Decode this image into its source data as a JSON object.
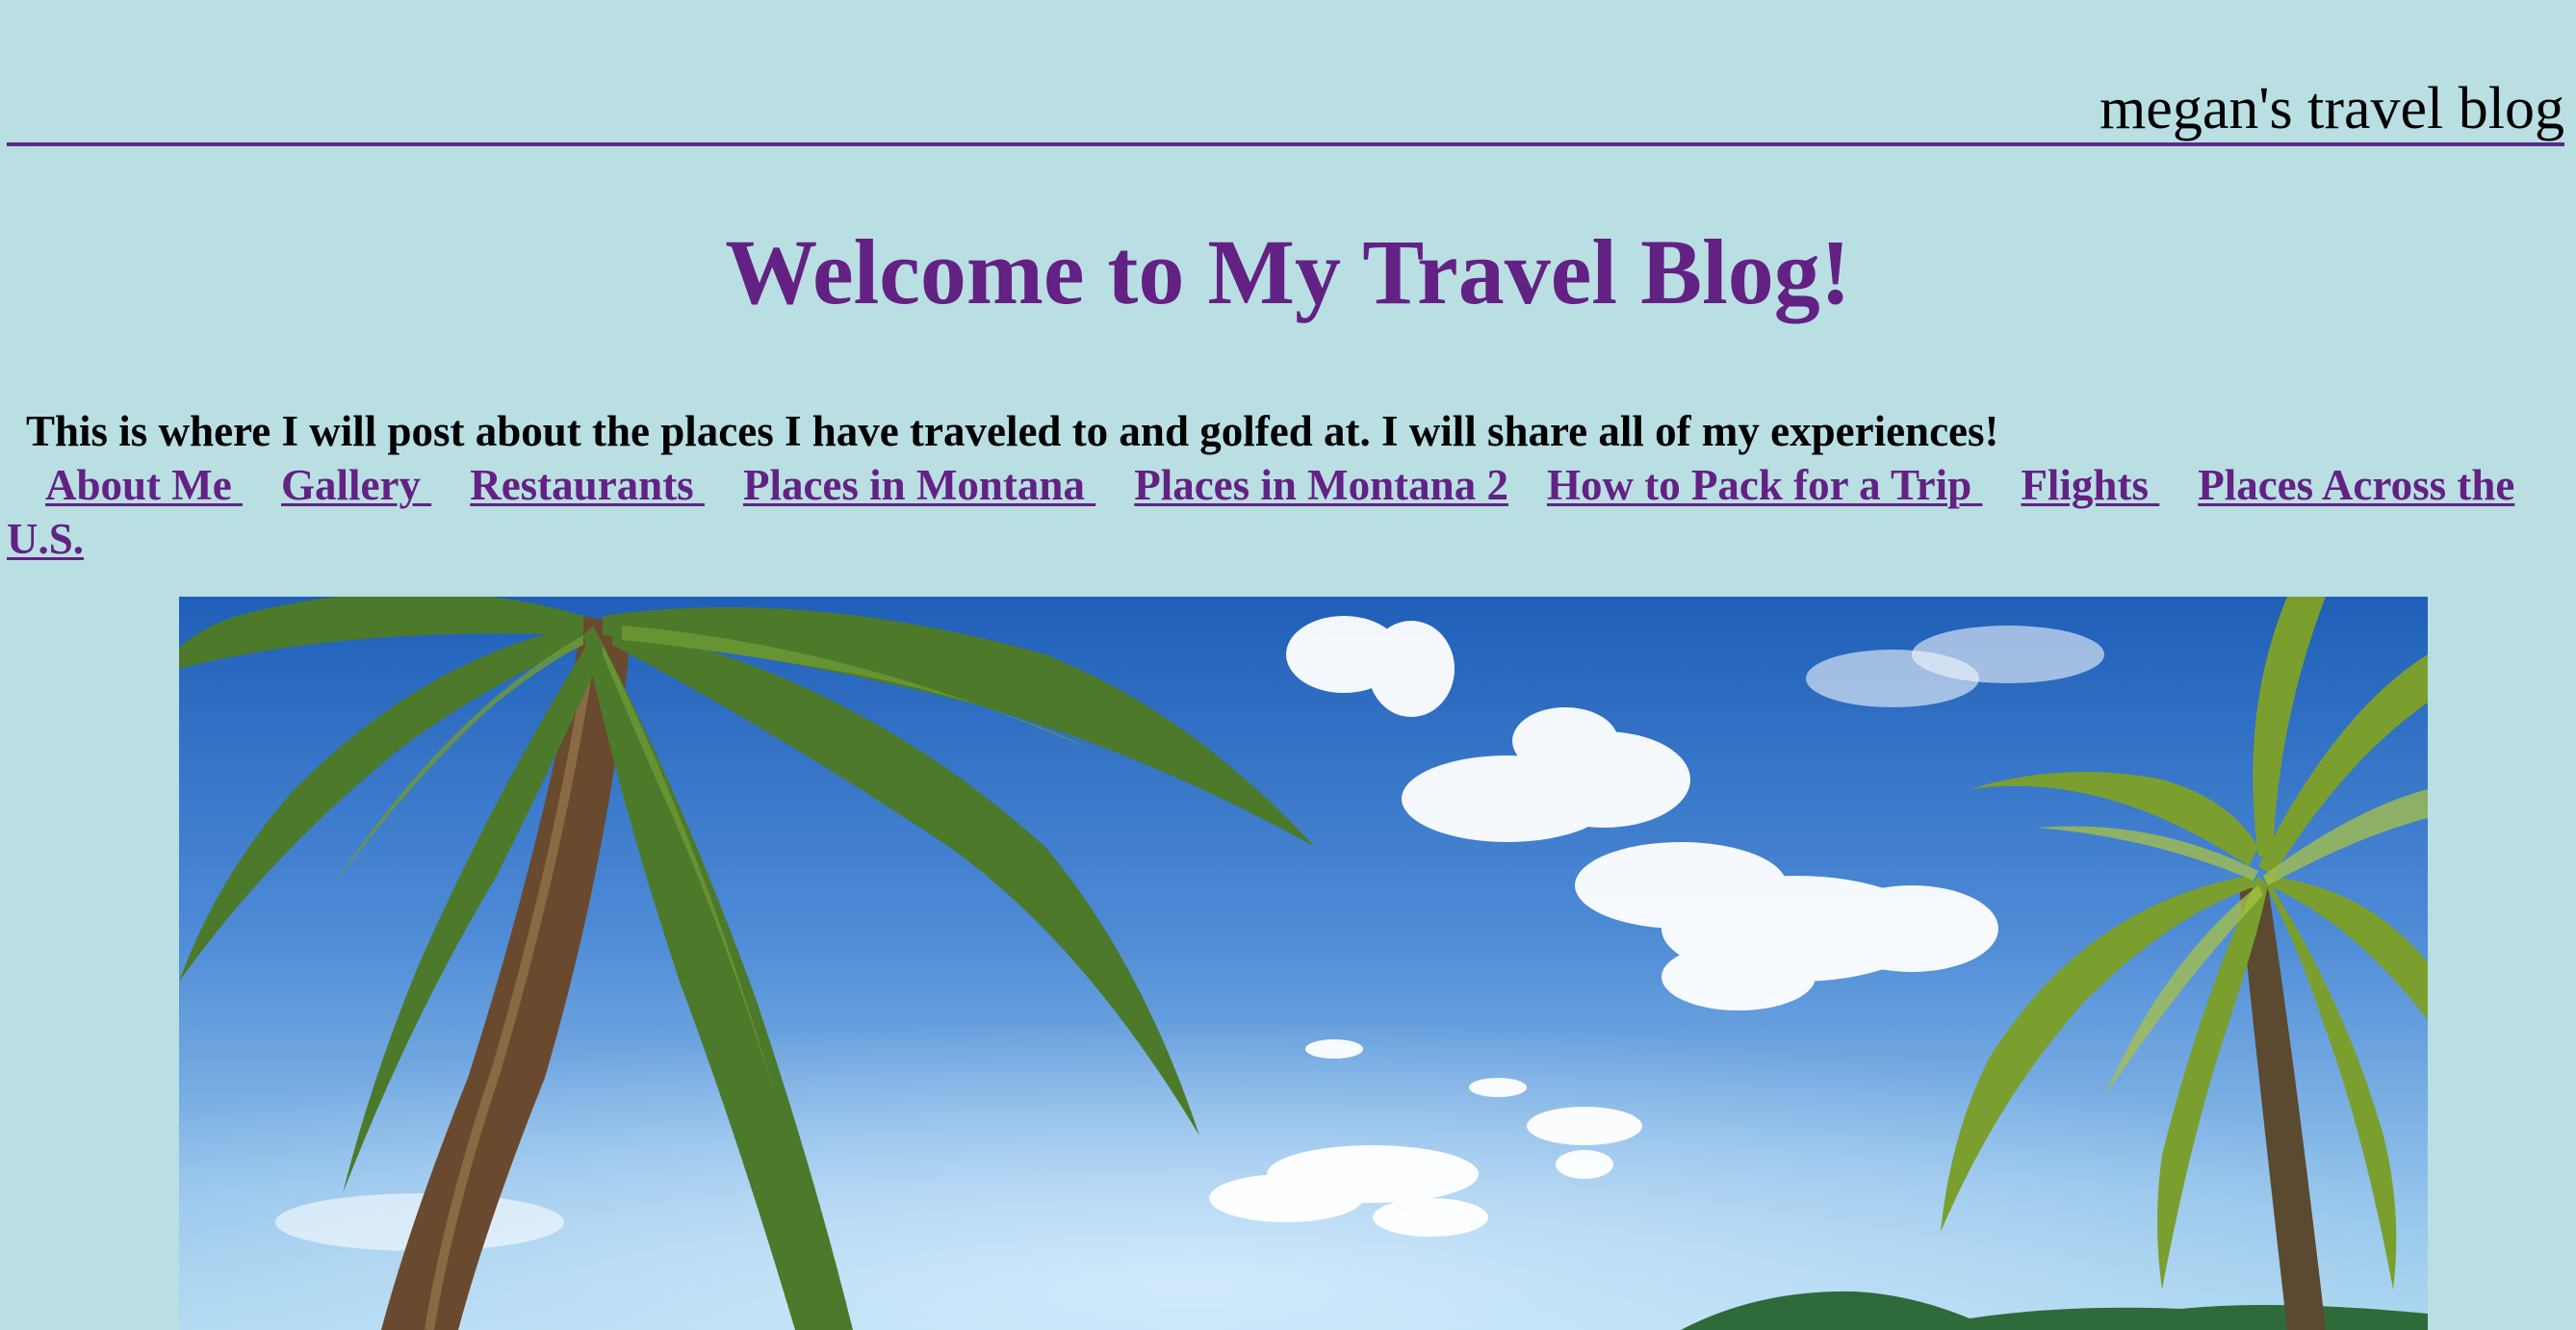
{
  "header": {
    "site_name": "megan's travel blog"
  },
  "main": {
    "title": "Welcome to My Travel Blog!",
    "intro": "This is where I will post about the places I have traveled to and golfed at. I will share all of my experiences!"
  },
  "nav": {
    "items": [
      {
        "label": "About Me "
      },
      {
        "label": "Gallery "
      },
      {
        "label": "Restaurants "
      },
      {
        "label": "Places in Montana "
      },
      {
        "label": "Places in Montana 2"
      },
      {
        "label": "How to Pack for a Trip "
      },
      {
        "label": "Flights "
      },
      {
        "label": "Places Across the U.S."
      }
    ]
  },
  "colors": {
    "background": "#b9dfe3",
    "accent": "#632183"
  },
  "hero": {
    "subject": "tropical-beach-palm-trees-photo"
  }
}
